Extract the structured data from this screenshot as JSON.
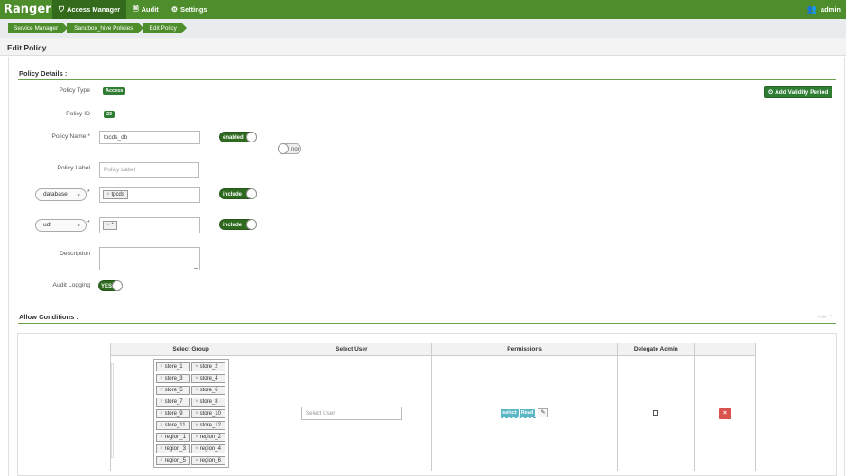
{
  "nav": {
    "brand": "Ranger",
    "items": [
      {
        "label": "Access Manager",
        "icon": "shield-icon",
        "glyph": "⛉",
        "active": true
      },
      {
        "label": "Audit",
        "icon": "document-icon",
        "glyph": "🗎",
        "active": false
      },
      {
        "label": "Settings",
        "icon": "gear-icon",
        "glyph": "⚙",
        "active": false
      }
    ],
    "user": "admin",
    "user_glyph": "👥"
  },
  "breadcrumb": [
    "Service Manager",
    "Sandbox_hive Policies",
    "Edit Policy"
  ],
  "page_title": "Edit Policy",
  "policy_details": {
    "section_title": "Policy Details :",
    "policy_type_label": "Policy Type",
    "policy_type": "Access",
    "add_validity_label": "Add Validity Period",
    "policy_id_label": "Policy ID",
    "policy_id": "23",
    "policy_name_label": "Policy Name *",
    "policy_name": "tpcds_db",
    "enabled_toggle": "enabled",
    "normal_toggle": "nor",
    "policy_label_label": "Policy Label",
    "policy_label_placeholder": "Policy Label",
    "resource1_type": "database",
    "resource1_value": "tpcds",
    "resource1_toggle": "include",
    "resource2_type": "udf",
    "resource2_value": "*",
    "resource2_toggle": "include",
    "description_label": "Description",
    "audit_logging_label": "Audit Logging",
    "audit_logging": "YES",
    "required_mark": "*",
    "tag_remove": "×",
    "chevron": "⌄"
  },
  "allow_conditions": {
    "section_title": "Allow Conditions :",
    "hide_label": "hide ⌃",
    "columns": [
      "Select Group",
      "Select User",
      "Permissions",
      "Delegate Admin",
      ""
    ],
    "groups": [
      "store_1",
      "store_2",
      "store_3",
      "store_4",
      "store_5",
      "store_6",
      "store_7",
      "store_8",
      "store_9",
      "store_10",
      "store_11",
      "store_12",
      "region_1",
      "region_2",
      "region_3",
      "region_4",
      "region_5",
      "region_6"
    ],
    "user_placeholder": "Select User",
    "permissions": [
      "select",
      "Read"
    ],
    "edit_glyph": "✎",
    "delete_glyph": "×"
  },
  "colors": {
    "nav_green": "#4e8d2c",
    "badge_green": "#2e7d32",
    "delete_red": "#d9534f",
    "perm_blue": "#5bb7c6"
  }
}
